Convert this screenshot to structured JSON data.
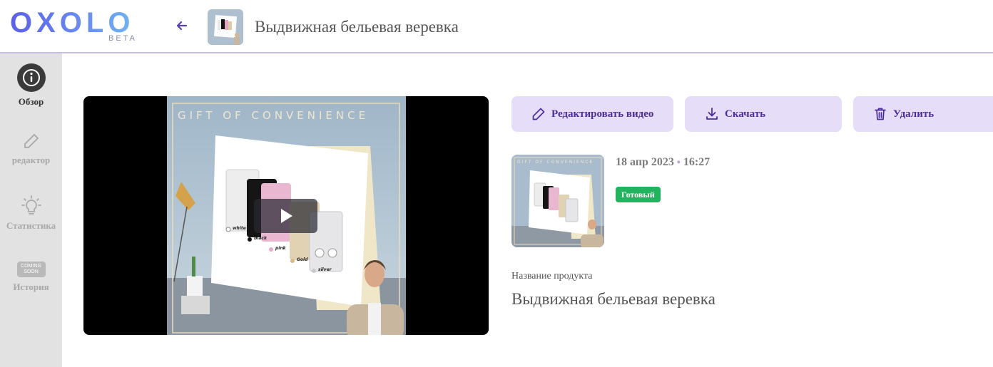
{
  "brand": {
    "name": "OXOLO",
    "tag": "BETA"
  },
  "header": {
    "title": "Выдвижная бельевая веревка"
  },
  "sidebar": {
    "items": [
      {
        "label": "Обзор",
        "icon": "info-icon",
        "active": true
      },
      {
        "label": "редактор",
        "icon": "pencil-icon",
        "active": false
      },
      {
        "label": "Статистика",
        "icon": "lightbulb-icon",
        "active": false
      },
      {
        "label": "История",
        "icon": "coming-soon-badge",
        "badge_line1": "COMING",
        "badge_line2": "SOON",
        "active": false
      }
    ]
  },
  "video": {
    "banner": "GIFT OF CONVENIENCE",
    "swatches": [
      "white",
      "black",
      "pink",
      "Gold",
      "silver"
    ]
  },
  "actions": {
    "edit_label": "Редактировать видео",
    "download_label": "Скачать",
    "delete_label": "Удалить"
  },
  "details": {
    "date": "18 апр 2023",
    "time": "16:27",
    "status": "Готовый",
    "product_label": "Название продукта",
    "product_name": "Выдвижная бельевая веревка"
  },
  "colors": {
    "accent": "#4b2e9e",
    "button_bg": "#e6def8",
    "status_green": "#21b45e",
    "sidebar_bg": "#e2e2e2"
  }
}
